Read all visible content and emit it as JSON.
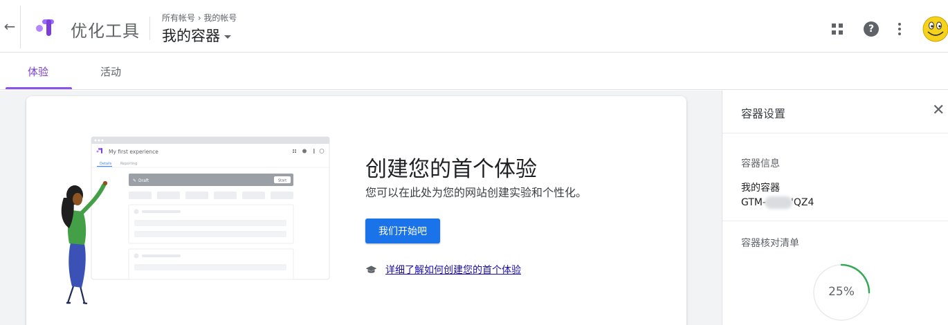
{
  "header": {
    "app_name": "优化工具",
    "breadcrumb": "所有帐号 › 我的帐号",
    "container_name": "我的容器",
    "icons": [
      "back-arrow-icon",
      "optimize-logo-icon",
      "apps-grid-icon",
      "help-icon",
      "more-vert-icon",
      "avatar-smiley-icon"
    ]
  },
  "tabs": [
    {
      "label": "体验",
      "active": true
    },
    {
      "label": "活动",
      "active": false
    }
  ],
  "main": {
    "title": "创建您的首个体验",
    "description": "您可以在此处为您的网站创建实验和个性化。",
    "start_button": "我们开始吧",
    "learn_link": "详细了解如何创建您的首个体验",
    "illustration": {
      "window_title": "My first experience",
      "tab_active": "Details",
      "tab_other": "Reporting",
      "draft_label": "Draft",
      "start_label": "Start"
    }
  },
  "panel": {
    "title": "容器设置",
    "info_label": "容器信息",
    "container_name": "我的容器",
    "container_id_prefix": "GTM-",
    "container_id_suffix": "'QZ4",
    "checklist_label": "容器核对清单",
    "checklist_progress": 25,
    "checklist_progress_text": "25%"
  },
  "colors": {
    "accent_purple": "#8e53e8",
    "primary_blue": "#1a73e8",
    "progress_green": "#34a853",
    "background_gray": "#f1f3f4"
  }
}
